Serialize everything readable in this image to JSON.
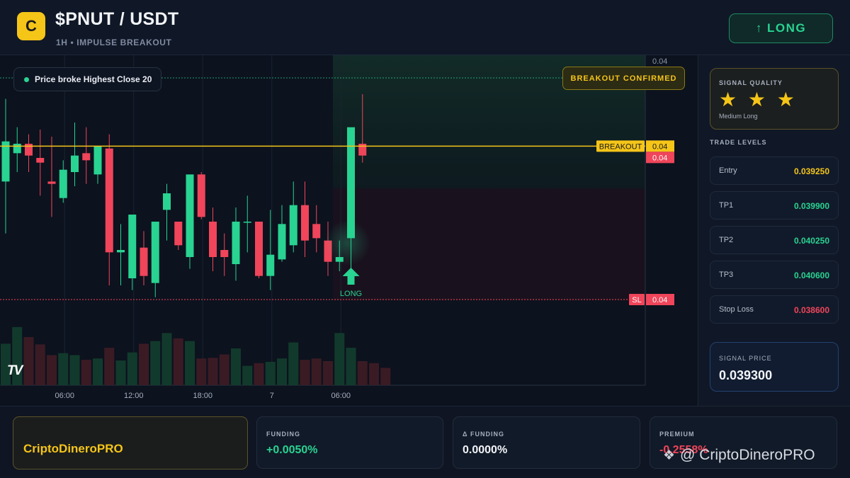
{
  "header": {
    "logo_letter": "C",
    "pair": "$PNUT / USDT",
    "subtitle": "1H • IMPULSE BREAKOUT",
    "signal_button": "↑ LONG"
  },
  "chart": {
    "status_pill": "Price broke Highest Close 20",
    "breakout_confirmed": "BREAKOUT CONFIRMED",
    "breakout_tag": "BREAKOUT",
    "sl_tag": "SL",
    "price_axis_labels": [
      "0.04",
      "0.04",
      "0.04",
      "0.04"
    ],
    "time_labels": [
      "06:00",
      "12:00",
      "18:00",
      "7",
      "06:00"
    ],
    "long_marker": "LONG",
    "tv_logo": "TV"
  },
  "chart_data": {
    "type": "candlestick",
    "candles": [
      {
        "o": 0.0391,
        "h": 0.03945,
        "l": 0.03888,
        "c": 0.03927
      },
      {
        "o": 0.03922,
        "h": 0.03933,
        "l": 0.03914,
        "c": 0.03926
      },
      {
        "o": 0.03926,
        "h": 0.0393,
        "l": 0.03914,
        "c": 0.03921
      },
      {
        "o": 0.0392,
        "h": 0.03932,
        "l": 0.03904,
        "c": 0.03918
      },
      {
        "o": 0.0391,
        "h": 0.03929,
        "l": 0.03895,
        "c": 0.03909
      },
      {
        "o": 0.03903,
        "h": 0.03919,
        "l": 0.03901,
        "c": 0.03915
      },
      {
        "o": 0.03914,
        "h": 0.03935,
        "l": 0.03908,
        "c": 0.03921
      },
      {
        "o": 0.03922,
        "h": 0.03933,
        "l": 0.03909,
        "c": 0.03919
      },
      {
        "o": 0.03913,
        "h": 0.03923,
        "l": 0.03909,
        "c": 0.03925
      },
      {
        "o": 0.03924,
        "h": 0.0393,
        "l": 0.03866,
        "c": 0.0388
      },
      {
        "o": 0.0388,
        "h": 0.03892,
        "l": 0.03866,
        "c": 0.03881
      },
      {
        "o": 0.03869,
        "h": 0.03895,
        "l": 0.03864,
        "c": 0.03896
      },
      {
        "o": 0.03882,
        "h": 0.03889,
        "l": 0.03866,
        "c": 0.0387
      },
      {
        "o": 0.03867,
        "h": 0.03891,
        "l": 0.03861,
        "c": 0.03893
      },
      {
        "o": 0.03898,
        "h": 0.03909,
        "l": 0.03885,
        "c": 0.03905
      },
      {
        "o": 0.03893,
        "h": 0.03893,
        "l": 0.03881,
        "c": 0.03883
      },
      {
        "o": 0.03878,
        "h": 0.03904,
        "l": 0.03873,
        "c": 0.03913
      },
      {
        "o": 0.03913,
        "h": 0.03914,
        "l": 0.03894,
        "c": 0.03895
      },
      {
        "o": 0.03893,
        "h": 0.03899,
        "l": 0.03872,
        "c": 0.03878
      },
      {
        "o": 0.03881,
        "h": 0.03888,
        "l": 0.0387,
        "c": 0.03878
      },
      {
        "o": 0.03875,
        "h": 0.03899,
        "l": 0.03868,
        "c": 0.03893
      },
      {
        "o": 0.03893,
        "h": 0.03904,
        "l": 0.0388,
        "c": 0.03893
      },
      {
        "o": 0.03893,
        "h": 0.0389,
        "l": 0.03869,
        "c": 0.0387
      },
      {
        "o": 0.0387,
        "h": 0.03898,
        "l": 0.03864,
        "c": 0.03879
      },
      {
        "o": 0.03877,
        "h": 0.039,
        "l": 0.03876,
        "c": 0.03892
      },
      {
        "o": 0.03883,
        "h": 0.0391,
        "l": 0.0388,
        "c": 0.039
      },
      {
        "o": 0.039,
        "h": 0.0391,
        "l": 0.03878,
        "c": 0.03885
      },
      {
        "o": 0.03892,
        "h": 0.039,
        "l": 0.0388,
        "c": 0.03886
      },
      {
        "o": 0.03885,
        "h": 0.03893,
        "l": 0.0387,
        "c": 0.03876
      },
      {
        "o": 0.03876,
        "h": 0.03885,
        "l": 0.03872,
        "c": 0.03878
      },
      {
        "o": 0.03886,
        "h": 0.03918,
        "l": 0.0387,
        "c": 0.03933
      },
      {
        "o": 0.03926,
        "h": 0.03947,
        "l": 0.03918,
        "c": 0.03921
      }
    ],
    "volumes": [
      62,
      87,
      72,
      61,
      45,
      48,
      45,
      38,
      40,
      56,
      37,
      49,
      62,
      66,
      78,
      70,
      66,
      40,
      41,
      46,
      55,
      29,
      33,
      35,
      40,
      64,
      38,
      40,
      36,
      78,
      56,
      36,
      33,
      26
    ],
    "levels": {
      "breakout": 0.03925,
      "stop_loss": 0.0386,
      "highest_close": 0.03945
    },
    "x_ticks": [
      "06:00",
      "12:00",
      "18:00",
      "7",
      "06:00"
    ],
    "y_ticks": [
      "0.04",
      "0.04",
      "0.04",
      "0.04"
    ],
    "signal_index": 30
  },
  "sidebar": {
    "quality_title": "SIGNAL QUALITY",
    "quality_stars": "★ ★ ★",
    "quality_label": "Medium Long",
    "levels_title": "TRADE LEVELS",
    "levels": [
      {
        "label": "Entry",
        "value": "0.039250",
        "color": "#f5c518"
      },
      {
        "label": "TP1",
        "value": "0.039900",
        "color": "#29d391"
      },
      {
        "label": "TP2",
        "value": "0.040250",
        "color": "#29d391"
      },
      {
        "label": "TP3",
        "value": "0.040600",
        "color": "#29d391"
      },
      {
        "label": "Stop Loss",
        "value": "0.038600",
        "color": "#f0455a"
      }
    ],
    "signal_price_title": "SIGNAL PRICE",
    "signal_price": "0.039300"
  },
  "footer": {
    "brand": "CriptoDineroPRO",
    "funding_title": "FUNDING",
    "funding_value": "+0.0050%",
    "delta_title": "Δ FUNDING",
    "delta_value": "0.0000%",
    "premium_title": "PREMIUM",
    "premium_value": "-0.2558%",
    "watermark": "@ CriptoDineroPRO"
  },
  "colors": {
    "up": "#29d391",
    "down": "#f0455a",
    "accent": "#f5c518",
    "bg": "#0f1522"
  }
}
